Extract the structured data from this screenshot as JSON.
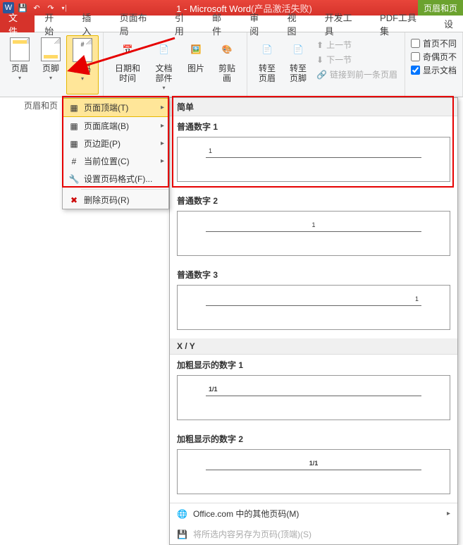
{
  "title": {
    "main": "1 - Microsoft Word",
    "suffix": "(产品激活失败)"
  },
  "context_tab": "页眉和页",
  "menu": {
    "file": "文件",
    "items": [
      "开始",
      "插入",
      "页面布局",
      "引用",
      "邮件",
      "审阅",
      "视图",
      "开发工具",
      "PDF工具集",
      "设"
    ]
  },
  "ribbon": {
    "header": "页眉",
    "footer": "页脚",
    "pagenum": "页码",
    "datetime": "日期和时间",
    "docparts": "文档部件",
    "picture": "图片",
    "clipart": "剪贴画",
    "goto_header": "转至页眉",
    "goto_footer": "转至页脚",
    "prev": "上一节",
    "next": "下一节",
    "link_prev": "链接到前一条页眉",
    "first_diff": "首页不同",
    "odd_even": "奇偶页不",
    "show_doc": "显示文档"
  },
  "hf_group_label": "页眉和页",
  "context_menu": {
    "top": "页面顶端(T)",
    "bottom": "页面底端(B)",
    "margin": "页边距(P)",
    "current": "当前位置(C)",
    "format": "设置页码格式(F)...",
    "remove": "删除页码(R)"
  },
  "gallery": {
    "section_simple": "简单",
    "items": [
      {
        "label": "普通数字 1",
        "text": "1",
        "align": "left"
      },
      {
        "label": "普通数字 2",
        "text": "1",
        "align": "center"
      },
      {
        "label": "普通数字 3",
        "text": "1",
        "align": "right"
      }
    ],
    "section_xy": "X / Y",
    "xy_items": [
      {
        "label": "加粗显示的数字 1",
        "text": "1/1",
        "align": "left"
      },
      {
        "label": "加粗显示的数字 2",
        "text": "1/1",
        "align": "center"
      }
    ],
    "footer_office": "Office.com 中的其他页码(M)",
    "footer_save": "将所选内容另存为页码(顶端)(S)"
  }
}
